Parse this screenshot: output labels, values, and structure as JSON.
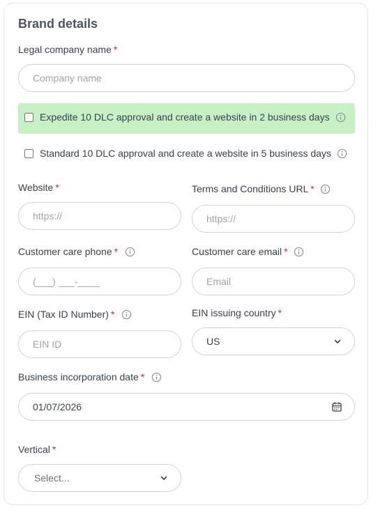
{
  "title": "Brand details",
  "required_mark": "*",
  "legal_name": {
    "label": "Legal company name",
    "placeholder": "Company name"
  },
  "options": {
    "expedite": "Expedite 10 DLC approval and create a website in 2 business days",
    "standard": "Standard 10 DLC approval and create a website in 5 business days"
  },
  "website": {
    "label": "Website",
    "placeholder": "https://"
  },
  "terms_url": {
    "label": "Terms and Conditions URL",
    "placeholder": "https://"
  },
  "care_phone": {
    "label": "Customer care phone",
    "placeholder": "(___) ___-____"
  },
  "care_email": {
    "label": "Customer care email",
    "placeholder": "Email"
  },
  "ein": {
    "label": "EIN (Tax ID Number)",
    "placeholder": "EIN ID"
  },
  "ein_country": {
    "label": "EIN issuing country",
    "value": "US"
  },
  "incorporation": {
    "label": "Business incorporation date",
    "value": "01/07/2026"
  },
  "vertical": {
    "label": "Vertical",
    "placeholder": "Select..."
  },
  "colors": {
    "highlight": "#c7f0c4",
    "required": "#dc2626",
    "border": "#d1d5db"
  },
  "icons": [
    "info-icon",
    "chevron-down-icon",
    "calendar-icon"
  ]
}
